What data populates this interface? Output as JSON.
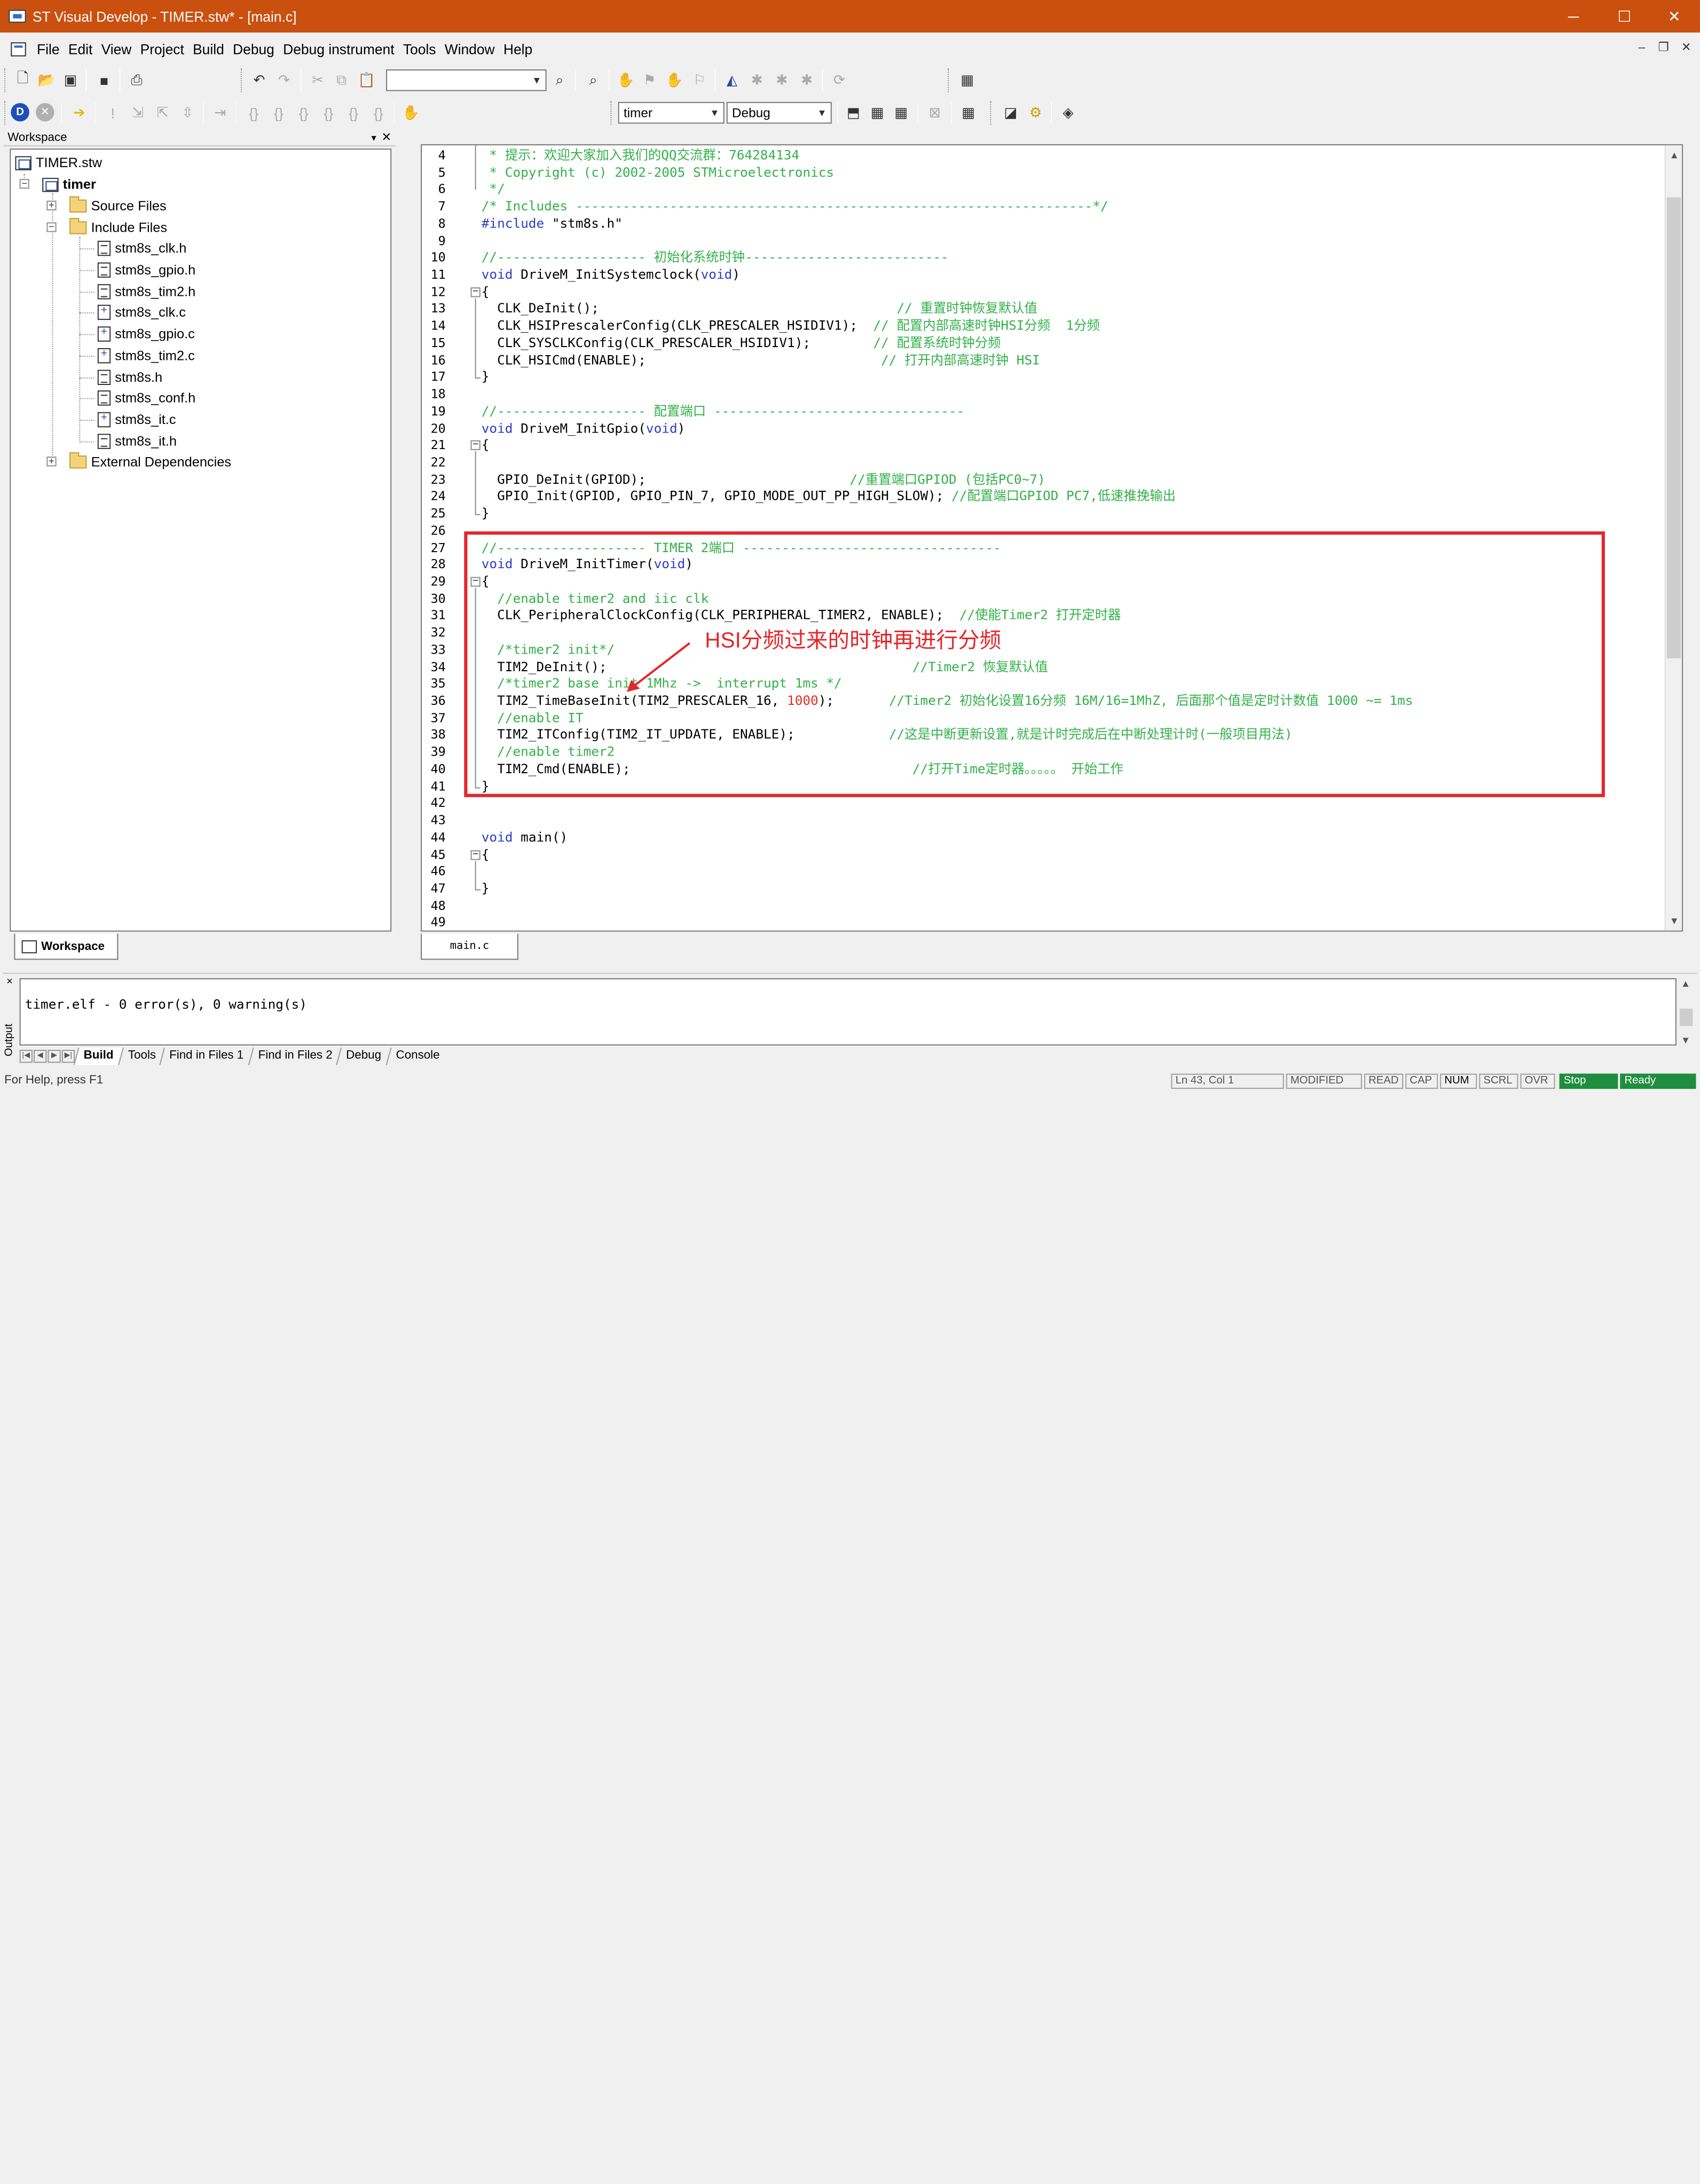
{
  "window": {
    "title": "ST Visual Develop - TIMER.stw* - [main.c]",
    "minimize": "─",
    "maximize": "☐",
    "close": "✕"
  },
  "menu": {
    "items": [
      "File",
      "Edit",
      "View",
      "Project",
      "Build",
      "Debug",
      "Debug instrument",
      "Tools",
      "Window",
      "Help"
    ],
    "mdi_min": "–",
    "mdi_restore": "❐",
    "mdi_close": "✕"
  },
  "toolbar": {
    "find_value": "",
    "project_combo": "timer",
    "config_combo": "Debug"
  },
  "workspace": {
    "panel_title": "Workspace",
    "tab_label": "Workspace",
    "root": "TIMER.stw",
    "project": "timer",
    "folders": [
      "Source Files",
      "Include Files",
      "External Dependencies"
    ],
    "files": [
      "stm8s_clk.h",
      "stm8s_gpio.h",
      "stm8s_tim2.h",
      "stm8s_clk.c",
      "stm8s_gpio.c",
      "stm8s_tim2.c",
      "stm8s.h",
      "stm8s_conf.h",
      "stm8s_it.c",
      "stm8s_it.h"
    ]
  },
  "editor": {
    "tab": "main.c",
    "lines": [
      {
        "n": "4",
        "segs": [
          {
            "c": "cm",
            "t": " * 提示：欢迎大家加入我们的QQ交流群：764284134"
          }
        ]
      },
      {
        "n": "5",
        "segs": [
          {
            "c": "cm",
            "t": " * Copyright (c) 2002-2005 STMicroelectronics"
          }
        ]
      },
      {
        "n": "6",
        "segs": [
          {
            "c": "cm",
            "t": " */"
          }
        ]
      },
      {
        "n": "7",
        "segs": [
          {
            "c": "cm",
            "t": "/* Includes ------------------------------------------------------------------*/"
          }
        ]
      },
      {
        "n": "8",
        "segs": [
          {
            "c": "pp",
            "t": "#include "
          },
          {
            "c": "st",
            "t": "\"stm8s.h\""
          }
        ]
      },
      {
        "n": "9",
        "segs": []
      },
      {
        "n": "10",
        "segs": [
          {
            "c": "cm",
            "t": "//------------------- 初始化系统时钟--------------------------"
          }
        ]
      },
      {
        "n": "11",
        "segs": [
          {
            "c": "kw",
            "t": "void"
          },
          {
            "c": "tx",
            "t": " DriveM_InitSystemclock("
          },
          {
            "c": "kw",
            "t": "void"
          },
          {
            "c": "tx",
            "t": ")"
          }
        ]
      },
      {
        "n": "12",
        "segs": [
          {
            "c": "tx",
            "t": "{"
          }
        ]
      },
      {
        "n": "13",
        "segs": [
          {
            "c": "tx",
            "t": "  CLK_DeInit();                                      "
          },
          {
            "c": "cm",
            "t": "// 重置时钟恢复默认值"
          }
        ]
      },
      {
        "n": "14",
        "segs": [
          {
            "c": "tx",
            "t": "  CLK_HSIPrescalerConfig(CLK_PRESCALER_HSIDIV1);  "
          },
          {
            "c": "cm",
            "t": "// 配置内部高速时钟HSI分频  1分频"
          }
        ]
      },
      {
        "n": "15",
        "segs": [
          {
            "c": "tx",
            "t": "  CLK_SYSCLKConfig(CLK_PRESCALER_HSIDIV1);        "
          },
          {
            "c": "cm",
            "t": "// 配置系统时钟分频"
          }
        ]
      },
      {
        "n": "16",
        "segs": [
          {
            "c": "tx",
            "t": "  CLK_HSICmd(ENABLE);                              "
          },
          {
            "c": "cm",
            "t": "// 打开内部高速时钟 HSI"
          }
        ]
      },
      {
        "n": "17",
        "segs": [
          {
            "c": "tx",
            "t": "}"
          }
        ]
      },
      {
        "n": "18",
        "segs": []
      },
      {
        "n": "19",
        "segs": [
          {
            "c": "cm",
            "t": "//------------------- 配置端口 --------------------------------"
          }
        ]
      },
      {
        "n": "20",
        "segs": [
          {
            "c": "kw",
            "t": "void"
          },
          {
            "c": "tx",
            "t": " DriveM_InitGpio("
          },
          {
            "c": "kw",
            "t": "void"
          },
          {
            "c": "tx",
            "t": ")"
          }
        ]
      },
      {
        "n": "21",
        "segs": [
          {
            "c": "tx",
            "t": "{"
          }
        ]
      },
      {
        "n": "22",
        "segs": []
      },
      {
        "n": "23",
        "segs": [
          {
            "c": "tx",
            "t": "  GPIO_DeInit(GPIOD);                          "
          },
          {
            "c": "cm",
            "t": "//重置端口GPIOD (包括PC0~7)"
          }
        ]
      },
      {
        "n": "24",
        "segs": [
          {
            "c": "tx",
            "t": "  GPIO_Init(GPIOD, GPIO_PIN_7, GPIO_MODE_OUT_PP_HIGH_SLOW); "
          },
          {
            "c": "cm",
            "t": "//配置端口GPIOD PC7,低速推挽输出"
          }
        ]
      },
      {
        "n": "25",
        "segs": [
          {
            "c": "tx",
            "t": "}"
          }
        ]
      },
      {
        "n": "26",
        "segs": []
      },
      {
        "n": "27",
        "segs": [
          {
            "c": "cm",
            "t": "//------------------- TIMER 2端口 ---------------------------------"
          }
        ]
      },
      {
        "n": "28",
        "segs": [
          {
            "c": "kw",
            "t": "void"
          },
          {
            "c": "tx",
            "t": " DriveM_InitTimer("
          },
          {
            "c": "kw",
            "t": "void"
          },
          {
            "c": "tx",
            "t": ")"
          }
        ]
      },
      {
        "n": "29",
        "segs": [
          {
            "c": "tx",
            "t": "{"
          }
        ]
      },
      {
        "n": "30",
        "segs": [
          {
            "c": "cm",
            "t": "  //enable timer2 and iic clk"
          }
        ]
      },
      {
        "n": "31",
        "segs": [
          {
            "c": "tx",
            "t": "  CLK_PeripheralClockConfig(CLK_PERIPHERAL_TIMER2, ENABLE);  "
          },
          {
            "c": "cm",
            "t": "//使能Timer2 打开定时器"
          }
        ]
      },
      {
        "n": "32",
        "segs": []
      },
      {
        "n": "33",
        "segs": [
          {
            "c": "cm",
            "t": "  /*timer2 init*/"
          }
        ]
      },
      {
        "n": "34",
        "segs": [
          {
            "c": "tx",
            "t": "  TIM2_DeInit();                                       "
          },
          {
            "c": "cm",
            "t": "//Timer2 恢复默认值"
          }
        ]
      },
      {
        "n": "35",
        "segs": [
          {
            "c": "cm",
            "t": "  /*timer2 base init 1Mhz ->  interrupt 1ms */"
          }
        ]
      },
      {
        "n": "36",
        "segs": [
          {
            "c": "tx",
            "t": "  TIM2_TimeBaseInit(TIM2_PRESCALER_16, "
          },
          {
            "c": "nm",
            "t": "1000"
          },
          {
            "c": "tx",
            "t": ");       "
          },
          {
            "c": "cm",
            "t": "//Timer2 初始化设置16分频 16M/16=1MhZ, 后面那个值是定时计数值 1000 ~= 1ms"
          }
        ]
      },
      {
        "n": "37",
        "segs": [
          {
            "c": "cm",
            "t": "  //enable IT"
          }
        ]
      },
      {
        "n": "38",
        "segs": [
          {
            "c": "tx",
            "t": "  TIM2_ITConfig(TIM2_IT_UPDATE, ENABLE);            "
          },
          {
            "c": "cm",
            "t": "//这是中断更新设置,就是计时完成后在中断处理计时(一般项目用法)"
          }
        ]
      },
      {
        "n": "39",
        "segs": [
          {
            "c": "cm",
            "t": "  //enable timer2"
          }
        ]
      },
      {
        "n": "40",
        "segs": [
          {
            "c": "tx",
            "t": "  TIM2_Cmd(ENABLE);                                    "
          },
          {
            "c": "cm",
            "t": "//打开Time定时器。。。。。 开始工作"
          }
        ]
      },
      {
        "n": "41",
        "segs": [
          {
            "c": "tx",
            "t": "}"
          }
        ]
      },
      {
        "n": "42",
        "segs": []
      },
      {
        "n": "43",
        "segs": []
      },
      {
        "n": "44",
        "segs": [
          {
            "c": "kw",
            "t": "void"
          },
          {
            "c": "tx",
            "t": " main()"
          }
        ]
      },
      {
        "n": "45",
        "segs": [
          {
            "c": "tx",
            "t": "{"
          }
        ]
      },
      {
        "n": "46",
        "segs": []
      },
      {
        "n": "47",
        "segs": [
          {
            "c": "tx",
            "t": "}"
          }
        ]
      },
      {
        "n": "48",
        "segs": []
      },
      {
        "n": "49",
        "segs": []
      }
    ]
  },
  "annotation": {
    "text": "HSI分频过来的时钟再进行分频",
    "color": "#e5262a"
  },
  "output": {
    "close": "×",
    "side_label": "Output",
    "text": "timer.elf - 0 error(s), 0 warning(s)",
    "tabs": [
      "Build",
      "Tools",
      "Find in Files 1",
      "Find in Files 2",
      "Debug",
      "Console"
    ],
    "active_tab": "Build"
  },
  "statusbar": {
    "help": "For Help, press F1",
    "position": "Ln 43, Col 1",
    "modified": "MODIFIED",
    "read": "READ",
    "cap": "CAP",
    "num": "NUM",
    "scrl": "SCRL",
    "ovr": "OVR",
    "stop": "Stop",
    "ready": "Ready"
  },
  "colors": {
    "titlebar": "#ca5010",
    "comment": "#33b04a",
    "keyword": "#2e3dc8",
    "number": "#e0301e",
    "annotation": "#e5262a"
  }
}
